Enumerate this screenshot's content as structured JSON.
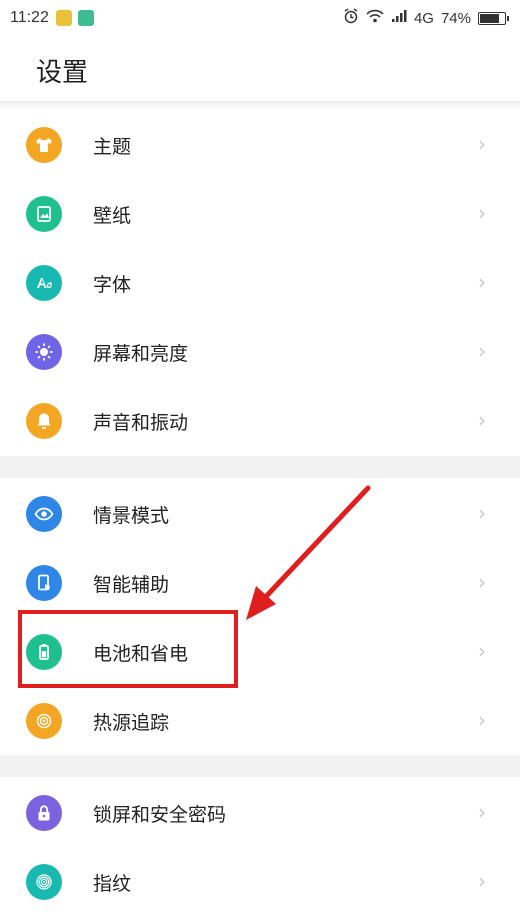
{
  "status_bar": {
    "time": "11:22",
    "network": "4G",
    "battery": "74%",
    "battery_level": 0.74
  },
  "header": {
    "title": "设置"
  },
  "groups": [
    {
      "items": [
        {
          "label": "主题",
          "icon": "shirt-icon",
          "color": "#f2a623"
        },
        {
          "label": "壁纸",
          "icon": "wallpaper-icon",
          "color": "#1fc08f"
        },
        {
          "label": "字体",
          "icon": "font-icon",
          "color": "#19b9b2"
        },
        {
          "label": "屏幕和亮度",
          "icon": "brightness-icon",
          "color": "#6f63e6"
        },
        {
          "label": "声音和振动",
          "icon": "bell-icon",
          "color": "#f2a623"
        }
      ]
    },
    {
      "items": [
        {
          "label": "情景模式",
          "icon": "eye-icon",
          "color": "#2e86e6"
        },
        {
          "label": "智能辅助",
          "icon": "phone-hand-icon",
          "color": "#2e86e6"
        },
        {
          "label": "电池和省电",
          "icon": "battery-icon",
          "color": "#1fc08f"
        },
        {
          "label": "热源追踪",
          "icon": "heat-icon",
          "color": "#f2a623"
        }
      ]
    },
    {
      "items": [
        {
          "label": "锁屏和安全密码",
          "icon": "lock-icon",
          "color": "#7b63e0"
        },
        {
          "label": "指纹",
          "icon": "fingerprint-icon",
          "color": "#19b9b2"
        }
      ]
    }
  ],
  "chevron": "›",
  "annotation_color": "#e01e1e"
}
